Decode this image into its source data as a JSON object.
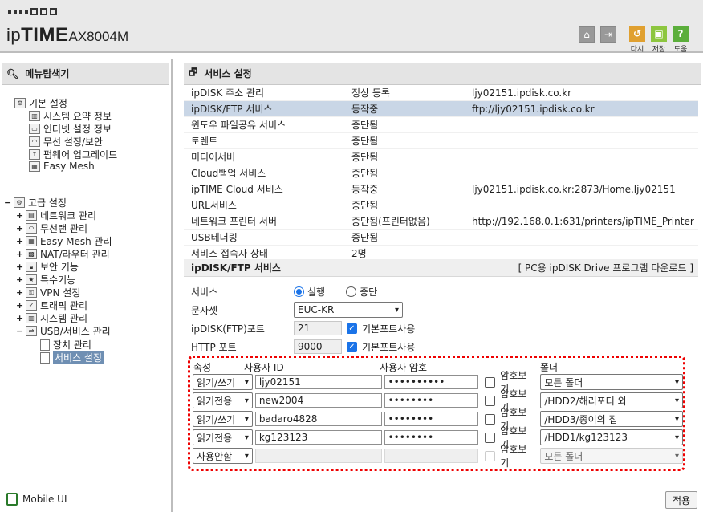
{
  "header": {
    "brand_ip": "ip",
    "brand_time": "TIME",
    "model": "AX8004M",
    "buttons": [
      {
        "label": "다시",
        "icon": "refresh-icon",
        "color": "#e0a030"
      },
      {
        "label": "저장",
        "icon": "save-icon",
        "color": "#8dc63f"
      },
      {
        "label": "도움",
        "icon": "help-icon",
        "color": "#5bae3b"
      }
    ]
  },
  "sidebar": {
    "title": "메뉴탐색기",
    "basic": {
      "label": "기본 설정",
      "items": [
        "시스템 요약 정보",
        "인터넷 설정 정보",
        "무선 설정/보안",
        "펌웨어 업그레이드",
        "Easy Mesh"
      ]
    },
    "advanced": {
      "label": "고급 설정",
      "items": [
        "네트워크 관리",
        "무선랜 관리",
        "Easy Mesh 관리",
        "NAT/라우터 관리",
        "보안 기능",
        "특수기능",
        "VPN 설정",
        "트래픽 관리",
        "시스템 관리",
        "USB/서비스 관리"
      ],
      "usb_children": [
        "장치 관리",
        "서비스 설정"
      ]
    },
    "mobile": "Mobile UI"
  },
  "main": {
    "title": "서비스 설정",
    "services": [
      {
        "name": "ipDISK 주소 관리",
        "status": "정상 등록",
        "detail": "ljy02151.ipdisk.co.kr"
      },
      {
        "name": "ipDISK/FTP 서비스",
        "status": "동작중",
        "detail": "ftp://ljy02151.ipdisk.co.kr"
      },
      {
        "name": "윈도우 파일공유 서비스",
        "status": "중단됨",
        "detail": ""
      },
      {
        "name": "토렌트",
        "status": "중단됨",
        "detail": ""
      },
      {
        "name": "미디어서버",
        "status": "중단됨",
        "detail": ""
      },
      {
        "name": "Cloud백업 서비스",
        "status": "중단됨",
        "detail": ""
      },
      {
        "name": "ipTIME Cloud 서비스",
        "status": "동작중",
        "detail": "ljy02151.ipdisk.co.kr:2873/Home.ljy02151"
      },
      {
        "name": "URL서비스",
        "status": "중단됨",
        "detail": ""
      },
      {
        "name": "네트워크 프린터 서버",
        "status": "중단됨(프린터없음)",
        "detail": "http://192.168.0.1:631/printers/ipTIME_Printer"
      },
      {
        "name": "USB테더링",
        "status": "중단됨",
        "detail": ""
      },
      {
        "name": "서비스 접속자 상태",
        "status": "2명",
        "detail": ""
      }
    ],
    "section_title": "ipDISK/FTP 서비스",
    "section_link": "[ PC용 ipDISK Drive 프로그램 다운로드 ]",
    "form": {
      "service_label": "서비스",
      "run_label": "실행",
      "stop_label": "중단",
      "charset_label": "문자셋",
      "charset_value": "EUC-KR",
      "ftp_port_label": "ipDISK(FTP)포트",
      "ftp_port_value": "21",
      "http_port_label": "HTTP 포트",
      "http_port_value": "9000",
      "default_port_label": "기본포트사용"
    },
    "accounts": {
      "headers": {
        "attr": "속성",
        "user": "사용자 ID",
        "password": "사용자 암호",
        "folder": "폴더"
      },
      "show_pw_label": "암호보기",
      "rows": [
        {
          "attr": "읽기/쓰기",
          "user": "ljy02151",
          "password": "••••••••••",
          "folder": "모든 폴더"
        },
        {
          "attr": "읽기전용",
          "user": "new2004",
          "password": "••••••••",
          "folder": "/HDD2/해리포터 외"
        },
        {
          "attr": "읽기/쓰기",
          "user": "badaro4828",
          "password": "••••••••",
          "folder": "/HDD3/종이의 집"
        },
        {
          "attr": "읽기전용",
          "user": "kg123123",
          "password": "••••••••",
          "folder": "/HDD1/kg123123"
        },
        {
          "attr": "사용안함",
          "user": "",
          "password": "",
          "folder": "모든 폴더"
        }
      ]
    },
    "apply_label": "적용"
  }
}
